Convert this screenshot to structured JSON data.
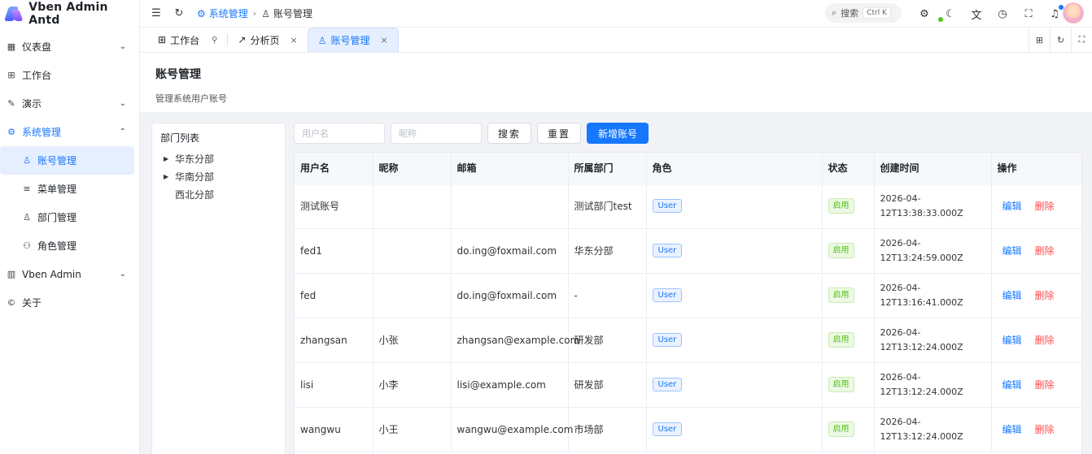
{
  "app": {
    "title": "Vben Admin Antd"
  },
  "sidebar": {
    "items": [
      {
        "label": "仪表盘",
        "icon": "dashboard-icon",
        "expandable": true
      },
      {
        "label": "工作台",
        "icon": "workbench-icon",
        "expandable": false
      },
      {
        "label": "演示",
        "icon": "demo-icon",
        "expandable": true
      },
      {
        "label": "系统管理",
        "icon": "settings-icon",
        "expandable": true,
        "open": true
      },
      {
        "label": "账号管理",
        "icon": "user-icon",
        "sub": true,
        "active": true
      },
      {
        "label": "菜单管理",
        "icon": "menu-icon",
        "sub": true
      },
      {
        "label": "部门管理",
        "icon": "org-icon",
        "sub": true
      },
      {
        "label": "角色管理",
        "icon": "role-icon",
        "sub": true
      },
      {
        "label": "Vben Admin",
        "icon": "vben-icon",
        "expandable": true
      },
      {
        "label": "关于",
        "icon": "copyright-icon",
        "expandable": false
      }
    ]
  },
  "header": {
    "breadcrumb": {
      "parent": "系统管理",
      "current": "账号管理"
    },
    "search": {
      "label": "搜索",
      "shortcut": "Ctrl K"
    }
  },
  "tabs": [
    {
      "label": "工作台",
      "pinned": true
    },
    {
      "label": "分析页",
      "closable": true
    },
    {
      "label": "账号管理",
      "closable": true,
      "active": true
    }
  ],
  "page": {
    "title": "账号管理",
    "description": "管理系统用户账号"
  },
  "dept_tree": {
    "title": "部门列表",
    "nodes": [
      {
        "label": "华东分部",
        "has_children": true
      },
      {
        "label": "华南分部",
        "has_children": true
      },
      {
        "label": "西北分部",
        "has_children": false
      }
    ]
  },
  "toolbar": {
    "username_placeholder": "用户名",
    "nickname_placeholder": "昵称",
    "search_label": "搜索",
    "reset_label": "重置",
    "add_label": "新增账号"
  },
  "table": {
    "columns": [
      "用户名",
      "昵称",
      "邮箱",
      "所属部门",
      "角色",
      "状态",
      "创建时间",
      "操作"
    ],
    "rows": [
      {
        "username": "测试账号",
        "nickname": "",
        "email": "",
        "dept": "测试部门test",
        "role": "User",
        "status": "启用",
        "created_line1": "2026-04-",
        "created_line2": "12T13:38:33.000Z"
      },
      {
        "username": "fed1",
        "nickname": "",
        "email": "do.ing@foxmail.com",
        "dept": "华东分部",
        "role": "User",
        "status": "启用",
        "created_line1": "2026-04-",
        "created_line2": "12T13:24:59.000Z"
      },
      {
        "username": "fed",
        "nickname": "",
        "email": "do.ing@foxmail.com",
        "dept": "-",
        "role": "User",
        "status": "启用",
        "created_line1": "2026-04-",
        "created_line2": "12T13:16:41.000Z"
      },
      {
        "username": "zhangsan",
        "nickname": "小张",
        "email": "zhangsan@example.com",
        "dept": "研发部",
        "role": "User",
        "status": "启用",
        "created_line1": "2026-04-",
        "created_line2": "12T13:12:24.000Z"
      },
      {
        "username": "lisi",
        "nickname": "小李",
        "email": "lisi@example.com",
        "dept": "研发部",
        "role": "User",
        "status": "启用",
        "created_line1": "2026-04-",
        "created_line2": "12T13:12:24.000Z"
      },
      {
        "username": "wangwu",
        "nickname": "小王",
        "email": "wangwu@example.com",
        "dept": "市场部",
        "role": "User",
        "status": "启用",
        "created_line1": "2026-04-",
        "created_line2": "12T13:12:24.000Z"
      }
    ],
    "edit_label": "编辑",
    "delete_label": "删除"
  }
}
